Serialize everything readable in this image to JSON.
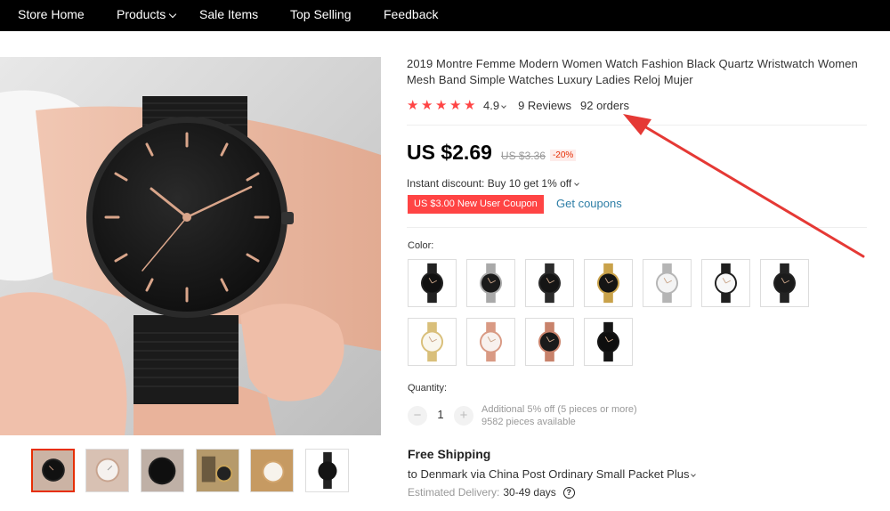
{
  "nav": {
    "items": [
      {
        "label": "Store Home"
      },
      {
        "label": "Products"
      },
      {
        "label": "Sale Items"
      },
      {
        "label": "Top Selling"
      },
      {
        "label": "Feedback"
      }
    ]
  },
  "product": {
    "title": "2019 Montre Femme Modern Women Watch Fashion Black Quartz Wristwatch Women Mesh Band Simple Watches Luxury Ladies Reloj Mujer",
    "rating": "4.9",
    "star_count": 5,
    "reviews": "9 Reviews",
    "orders": "92 orders",
    "price": "US $2.69",
    "old_price": "US $3.36",
    "discount": "-20%",
    "instant_discount": "Instant discount: Buy 10 get 1% off",
    "coupon": "US $3.00 New User Coupon",
    "get_coupons": "Get coupons",
    "color_label": "Color:",
    "quantity_label": "Quantity:",
    "quantity_value": "1",
    "qty_minus": "−",
    "qty_plus": "+",
    "additional_off": "Additional 5% off (5 pieces or more)",
    "pieces_available": "9582 pieces available",
    "shipping_title": "Free Shipping",
    "shipping_dest": "to Denmark via China Post Ordinary Small Packet Plus",
    "estimated_label": "Estimated Delivery:",
    "estimated_days": "30-49 days"
  },
  "colors": {
    "accent": "#e62e04",
    "star": "#ff4444",
    "link": "#2e7ea6",
    "annotation_arrow": "#e53935"
  },
  "swatches": [
    {
      "name": "black-mesh",
      "band": "#222222",
      "face": "#111111"
    },
    {
      "name": "silver-black",
      "band": "#a9a9a9",
      "face": "#1a1a1a"
    },
    {
      "name": "black-rose",
      "band": "#2b2b2b",
      "face": "#151515"
    },
    {
      "name": "gold-black",
      "band": "#c9a24a",
      "face": "#141414"
    },
    {
      "name": "silver-white",
      "band": "#b5b5b5",
      "face": "#f4f4f4"
    },
    {
      "name": "black-white",
      "band": "#1f1f1f",
      "face": "#f7f7f7"
    },
    {
      "name": "black-gold",
      "band": "#232323",
      "face": "#1b1b1b"
    },
    {
      "name": "gold-white",
      "band": "#d9bf7a",
      "face": "#faf7ee"
    },
    {
      "name": "rosegold-white",
      "band": "#d99a84",
      "face": "#f8f1ee"
    },
    {
      "name": "rosegold-black",
      "band": "#c8826b",
      "face": "#1a1a1a"
    },
    {
      "name": "all-black",
      "band": "#161616",
      "face": "#0e0e0e"
    }
  ],
  "thumbnails": [
    {
      "name": "thumb-black-wrist"
    },
    {
      "name": "thumb-white-wrist"
    },
    {
      "name": "thumb-black-closeup"
    },
    {
      "name": "thumb-gold-lifestyle"
    },
    {
      "name": "thumb-white-lifestyle"
    },
    {
      "name": "thumb-black-product"
    }
  ]
}
